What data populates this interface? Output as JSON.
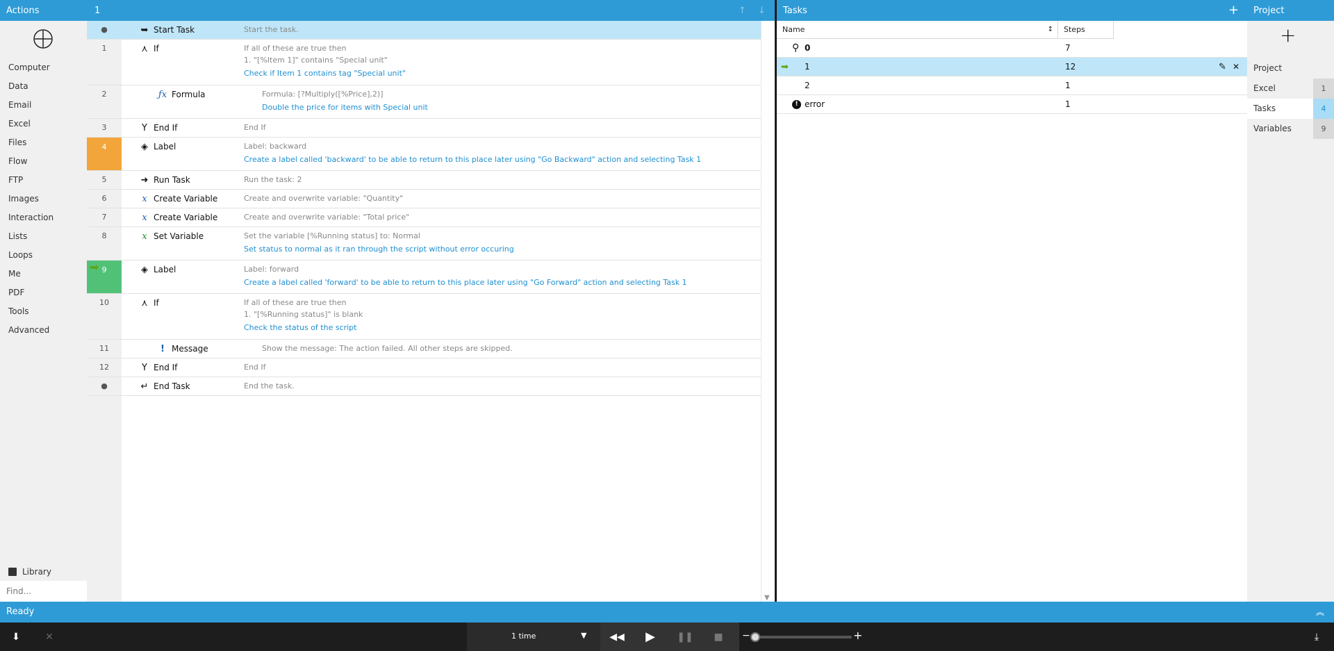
{
  "actions": {
    "header": "Actions",
    "categories": [
      "Computer",
      "Data",
      "Email",
      "Excel",
      "Files",
      "Flow",
      "FTP",
      "Images",
      "Interaction",
      "Lists",
      "Loops",
      "Me",
      "PDF",
      "Tools",
      "Advanced"
    ],
    "library": "Library",
    "find_placeholder": "Find..."
  },
  "script": {
    "header": "1",
    "rows": [
      {
        "num": "●",
        "name": "Start Task",
        "desc": [
          "Start the task."
        ],
        "comment": "",
        "icon": "start-task-icon"
      },
      {
        "num": "1",
        "name": "If",
        "desc": [
          "If all of these are true then",
          "1. \"[%Item 1]\" contains \"Special unit\""
        ],
        "comment": "Check if Item 1 contains tag \"Special unit\"",
        "icon": "if-icon"
      },
      {
        "num": "2",
        "name": "Formula",
        "desc": [
          "Formula: [?Multiply([%Price],2)]"
        ],
        "comment": "Double the price for items with Special unit",
        "icon": "formula-icon"
      },
      {
        "num": "3",
        "name": "End If",
        "desc": [
          "End If"
        ],
        "comment": "",
        "icon": "end-if-icon"
      },
      {
        "num": "4",
        "name": "Label",
        "desc": [
          "Label: backward"
        ],
        "comment": "Create a label called 'backward' to be able to return to this place later using \"Go Backward\" action and selecting Task 1",
        "icon": "label-icon"
      },
      {
        "num": "5",
        "name": "Run Task",
        "desc": [
          "Run the task: 2"
        ],
        "comment": "",
        "icon": "run-task-icon"
      },
      {
        "num": "6",
        "name": "Create Variable",
        "desc": [
          "Create and overwrite variable: \"Quantity\""
        ],
        "comment": "",
        "icon": "create-variable-icon"
      },
      {
        "num": "7",
        "name": "Create Variable",
        "desc": [
          "Create and overwrite variable: \"Total price\""
        ],
        "comment": "",
        "icon": "create-variable-icon"
      },
      {
        "num": "8",
        "name": "Set Variable",
        "desc": [
          "Set the variable [%Running status] to: Normal"
        ],
        "comment": "Set status to normal as it ran through the script without error occuring",
        "icon": "set-variable-icon"
      },
      {
        "num": "9",
        "name": "Label",
        "desc": [
          "Label: forward"
        ],
        "comment": "Create a label called 'forward' to be able to return to this place later using \"Go Forward\" action and selecting Task 1",
        "icon": "label-icon"
      },
      {
        "num": "10",
        "name": "If",
        "desc": [
          "If all of these are true then",
          "1. \"[%Running status]\" is blank"
        ],
        "comment": "Check the status of the script",
        "icon": "if-icon"
      },
      {
        "num": "11",
        "name": "Message",
        "desc": [
          "Show the message: The action failed. All other steps are skipped."
        ],
        "comment": "",
        "icon": "message-icon"
      },
      {
        "num": "12",
        "name": "End If",
        "desc": [
          "End If"
        ],
        "comment": "",
        "icon": "end-if-icon"
      },
      {
        "num": "●",
        "name": "End Task",
        "desc": [
          "End the task."
        ],
        "comment": "",
        "icon": "end-task-icon"
      }
    ]
  },
  "tasks": {
    "header": "Tasks",
    "col_name": "Name",
    "col_steps": "Steps",
    "rows": [
      {
        "name": "0",
        "steps": "7",
        "icon": "pin-icon"
      },
      {
        "name": "1",
        "steps": "12",
        "icon": "current-arrow-icon"
      },
      {
        "name": "2",
        "steps": "1",
        "icon": ""
      },
      {
        "name": "error",
        "steps": "1",
        "icon": "error-icon"
      }
    ]
  },
  "project": {
    "header": "Project",
    "title": "Project",
    "items": [
      {
        "label": "Excel",
        "count": "1"
      },
      {
        "label": "Tasks",
        "count": "4"
      },
      {
        "label": "Variables",
        "count": "9"
      }
    ]
  },
  "status": {
    "text": "Ready"
  },
  "bottom": {
    "repeat": "1 time"
  },
  "colors": {
    "accent": "#2e9bd6",
    "selected_row": "#bfe6f8",
    "label_orange": "#f2a53a",
    "label_green": "#52c178",
    "comment_blue": "#1f8fd1"
  }
}
